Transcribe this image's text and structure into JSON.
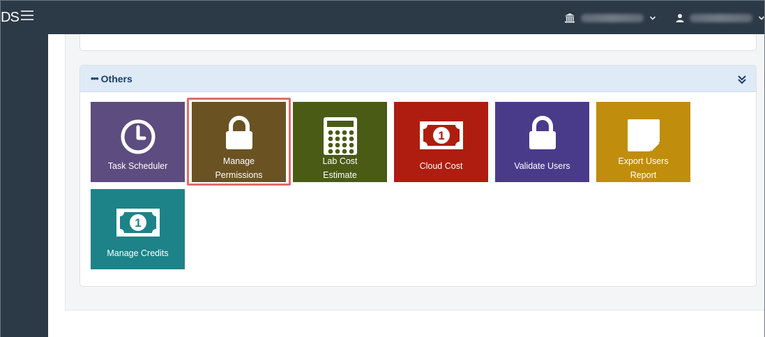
{
  "header": {
    "logo_text": "DS",
    "org_icon": "institution-icon",
    "user_icon": "user-icon"
  },
  "section": {
    "title": "Others",
    "collapse_icon": "double-chevron-down-icon"
  },
  "tiles": [
    {
      "label_lines": [
        "Task Scheduler"
      ],
      "color": "#5d4c7f",
      "icon": "clock-icon"
    },
    {
      "label_lines": [
        "Manage",
        "Permissions"
      ],
      "color": "#6b5223",
      "icon": "lock-icon"
    },
    {
      "label_lines": [
        "Lab Cost",
        "Estimate"
      ],
      "color": "#4a5b16",
      "icon": "calculator-icon"
    },
    {
      "label_lines": [
        "Cloud Cost"
      ],
      "color": "#ae1d10",
      "icon": "money-icon"
    },
    {
      "label_lines": [
        "Validate Users"
      ],
      "color": "#4a3b8a",
      "icon": "lock-icon"
    },
    {
      "label_lines": [
        "Export Users",
        "Report"
      ],
      "color": "#c08d0d",
      "icon": "document-icon"
    },
    {
      "label_lines": [
        "Manage Credits"
      ],
      "color": "#1d8389",
      "icon": "money-icon"
    }
  ],
  "colors": {
    "topbar": "#2c3a47",
    "highlight": "#e26b6b",
    "section_header_bg": "#dfeaf7",
    "section_title": "#1b3d66"
  }
}
